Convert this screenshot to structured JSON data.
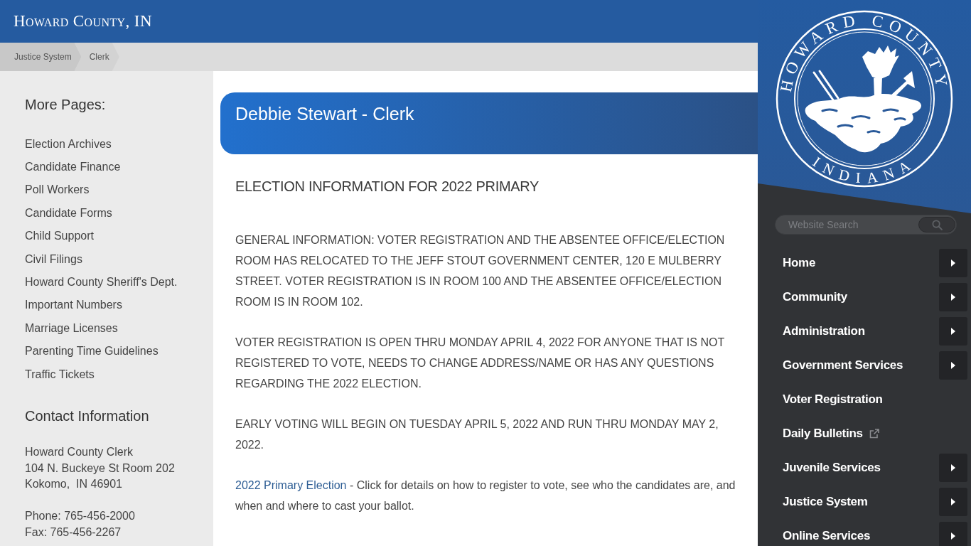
{
  "header": {
    "title": "Howard County, IN"
  },
  "breadcrumb": [
    {
      "label": "Justice System"
    },
    {
      "label": "Clerk"
    }
  ],
  "sidebar": {
    "heading": "More Pages:",
    "links": [
      "Election Archives",
      "Candidate Finance",
      "Poll Workers",
      "Candidate Forms",
      "Child Support",
      "Civil Filings",
      "Howard County Sheriff's Dept.",
      "Important Numbers",
      "Marriage Licenses",
      "Parenting Time Guidelines",
      "Traffic Tickets"
    ],
    "contact": {
      "heading": "Contact Information",
      "address_lines": [
        "Howard County Clerk",
        "104 N. Buckeye St Room 202",
        "Kokomo,  IN 46901"
      ],
      "phone": "Phone: 765-456-2000",
      "fax": "Fax: 765-456-2267"
    }
  },
  "main": {
    "title": "Debbie Stewart - Clerk",
    "subheading": "ELECTION INFORMATION FOR 2022 PRIMARY",
    "paragraphs": [
      {
        "kind": "text",
        "text": "GENERAL INFORMATION: VOTER REGISTRATION AND THE ABSENTEE OFFICE/ELECTION ROOM HAS RELOCATED TO THE JEFF STOUT GOVERNMENT CENTER, 120 E MULBERRY STREET. VOTER REGISTRATION IS IN ROOM 100 AND THE ABSENTEE OFFICE/ELECTION ROOM IS IN ROOM 102."
      },
      {
        "kind": "text",
        "text": "VOTER REGISTRATION IS OPEN THRU MONDAY APRIL 4, 2022 FOR ANYONE THAT IS NOT REGISTERED TO VOTE, NEEDS TO CHANGE ADDRESS/NAME OR HAS ANY QUESTIONS REGARDING THE 2022 ELECTION."
      },
      {
        "kind": "text",
        "text": "EARLY VOTING WILL BEGIN ON TUESDAY APRIL 5, 2022 AND RUN THRU MONDAY MAY 2, 2022."
      },
      {
        "kind": "link",
        "link": "2022 Primary Election",
        "text": " - Click for details on how to register to vote, see who the candidates are, and when and where to cast your ballot."
      }
    ]
  },
  "seal": {
    "top_text": "HOWARD COUNTY",
    "bottom_text": "INDIANA"
  },
  "search": {
    "placeholder": "Website Search"
  },
  "nav": [
    {
      "label": "Home",
      "kind": "submenu"
    },
    {
      "label": "Community",
      "kind": "submenu"
    },
    {
      "label": "Administration",
      "kind": "submenu"
    },
    {
      "label": "Government Services",
      "kind": "submenu"
    },
    {
      "label": "Voter Registration",
      "kind": "link"
    },
    {
      "label": "Daily Bulletins",
      "kind": "external"
    },
    {
      "label": "Juvenile Services",
      "kind": "submenu"
    },
    {
      "label": "Justice System",
      "kind": "submenu"
    },
    {
      "label": "Online Services",
      "kind": "submenu"
    }
  ]
}
